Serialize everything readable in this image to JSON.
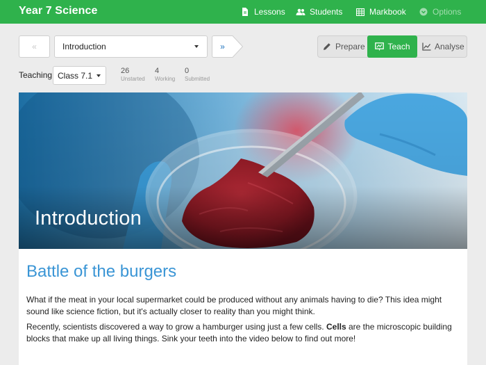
{
  "app": {
    "title": "Year 7 Science"
  },
  "nav": {
    "items": [
      {
        "label": "Lessons",
        "icon": "document-icon"
      },
      {
        "label": "Students",
        "icon": "users-icon"
      },
      {
        "label": "Markbook",
        "icon": "table-icon"
      },
      {
        "label": "Options",
        "icon": "circle-chevron-icon"
      }
    ]
  },
  "toolbar": {
    "prev_label": "«",
    "next_label": "»",
    "lesson_select": "Introduction",
    "modes": [
      {
        "label": "Prepare",
        "icon": "pencil-icon",
        "active": false
      },
      {
        "label": "Teach",
        "icon": "whiteboard-icon",
        "active": true
      },
      {
        "label": "Analyse",
        "icon": "line-chart-icon",
        "active": false
      }
    ]
  },
  "teaching": {
    "label": "Teaching",
    "class_select": "Class 7.1",
    "stats": [
      {
        "value": "26",
        "label": "Unstarted"
      },
      {
        "value": "4",
        "label": "Working"
      },
      {
        "value": "0",
        "label": "Submitted"
      }
    ]
  },
  "content": {
    "hero_title": "Introduction",
    "heading": "Battle of the burgers",
    "para1": "What if the meat in your local supermarket could be produced without any animals having to die? This idea might sound like science fiction, but it's actually closer to reality than you might think.",
    "para2_before": "Recently, scientists discovered a way to grow a hamburger using just a few cells. ",
    "para2_bold": "Cells",
    "para2_after": " are the microscopic building blocks that make up all living things. Sink your teeth into the video below to find out more!"
  },
  "colors": {
    "brand_green": "#2fb24c",
    "heading_blue": "#3a95d5",
    "link_blue": "#1e73be"
  }
}
